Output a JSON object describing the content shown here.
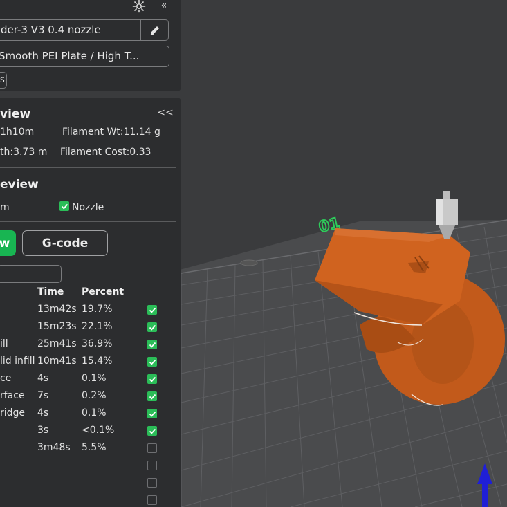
{
  "header": {
    "printer": "der-3 V3 0.4 nozzle",
    "plate": "Smooth PEI Plate / High T...",
    "small_button": "s"
  },
  "summary": {
    "title": "view",
    "collapse_label": "<<",
    "time": "1h10m",
    "filament_weight": "Filament Wt:11.14 g",
    "length": "th:3.73 m",
    "filament_cost": "Filament Cost:0.33"
  },
  "preview": {
    "title": "eview",
    "option_left": "m",
    "nozzle_label": "Nozzle",
    "nozzle_checked": true
  },
  "tabs": {
    "view_label": "w",
    "gcode_label": "G-code"
  },
  "table": {
    "headers": [
      "Time",
      "Percent"
    ],
    "rows": [
      {
        "name": "",
        "time": "13m42s",
        "percent": "19.7%",
        "checked": true
      },
      {
        "name": "",
        "time": "15m23s",
        "percent": "22.1%",
        "checked": true
      },
      {
        "name": "ill",
        "time": "25m41s",
        "percent": "36.9%",
        "checked": true
      },
      {
        "name": "lid infill",
        "time": "10m41s",
        "percent": "15.4%",
        "checked": true
      },
      {
        "name": "ce",
        "time": "4s",
        "percent": "0.1%",
        "checked": true
      },
      {
        "name": "rface",
        "time": "7s",
        "percent": "0.2%",
        "checked": true
      },
      {
        "name": "ridge",
        "time": "4s",
        "percent": "0.1%",
        "checked": true
      },
      {
        "name": "",
        "time": "3s",
        "percent": "<0.1%",
        "checked": true
      },
      {
        "name": "",
        "time": "3m48s",
        "percent": "5.5%",
        "checked": false
      },
      {
        "name": "",
        "time": "",
        "percent": "",
        "checked": false
      },
      {
        "name": "",
        "time": "",
        "percent": "",
        "checked": false
      },
      {
        "name": "",
        "time": "",
        "percent": "",
        "checked": false
      }
    ]
  },
  "viewport": {
    "plate_label": "01",
    "model_color": "#c8601e",
    "background_color": "#3a3b3d"
  },
  "icons": {
    "settings": "gear-icon",
    "collapse": "double-chevron-left-icon",
    "edit": "pencil-icon"
  }
}
